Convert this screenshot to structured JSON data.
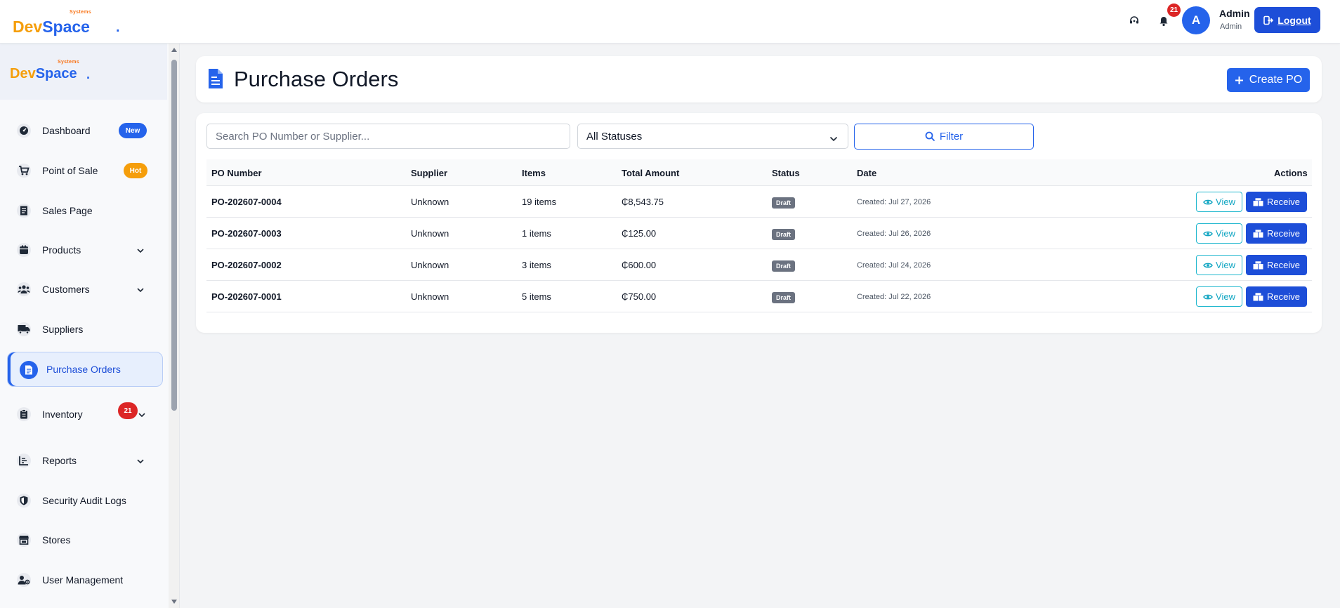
{
  "brand": {
    "small": "Systems",
    "dev": "Dev",
    "space": "Space",
    "dot": "."
  },
  "header": {
    "notification_count": "21",
    "avatar_initial": "A",
    "user_name": "Admin",
    "user_role": "Admin",
    "logout_label": "Logout",
    "icons": [
      "headset-icon",
      "bell-icon",
      "logout-icon"
    ]
  },
  "sidebar": {
    "items": [
      {
        "label": "Dashboard",
        "icon": "dashboard-icon",
        "pill": "New",
        "pill_color": "#2563eb"
      },
      {
        "label": "Point of Sale",
        "icon": "cart-icon",
        "pill": "Hot",
        "pill_color": "#f59e0b"
      },
      {
        "label": "Sales Page",
        "icon": "receipt-icon"
      },
      {
        "label": "Products",
        "icon": "box-icon",
        "expandable": true
      },
      {
        "label": "Customers",
        "icon": "users-icon",
        "expandable": true
      },
      {
        "label": "Suppliers",
        "icon": "truck-icon"
      },
      {
        "label": "Purchase Orders",
        "icon": "file-icon",
        "active": true
      },
      {
        "label": "Inventory",
        "icon": "clipboard-icon",
        "expandable": true,
        "badge": "21"
      },
      {
        "label": "Reports",
        "icon": "chart-icon",
        "expandable": true
      },
      {
        "label": "Security Audit Logs",
        "icon": "shield-icon"
      },
      {
        "label": "Stores",
        "icon": "store-icon"
      },
      {
        "label": "User Management",
        "icon": "user-cog-icon"
      }
    ]
  },
  "page": {
    "title": "Purchase Orders",
    "create_label": "Create PO"
  },
  "filters": {
    "search_placeholder": "Search PO Number or Supplier...",
    "status_selected": "All Statuses",
    "filter_label": "Filter"
  },
  "table": {
    "headers": [
      "PO Number",
      "Supplier",
      "Items",
      "Total Amount",
      "Status",
      "Date",
      "Actions"
    ],
    "rows": [
      {
        "po": "PO-202607-0004",
        "supplier": "Unknown",
        "items": "19 items",
        "total": "₵8,543.75",
        "status": "Draft",
        "date": "Created: Jul 27, 2026"
      },
      {
        "po": "PO-202607-0003",
        "supplier": "Unknown",
        "items": "1 items",
        "total": "₵125.00",
        "status": "Draft",
        "date": "Created: Jul 26, 2026"
      },
      {
        "po": "PO-202607-0002",
        "supplier": "Unknown",
        "items": "3 items",
        "total": "₵600.00",
        "status": "Draft",
        "date": "Created: Jul 24, 2026"
      },
      {
        "po": "PO-202607-0001",
        "supplier": "Unknown",
        "items": "5 items",
        "total": "₵750.00",
        "status": "Draft",
        "date": "Created: Jul 22, 2026"
      }
    ],
    "view_label": "View",
    "receive_label": "Receive"
  },
  "colors": {
    "primary": "#2563eb",
    "primary_dark": "#1d4ed8",
    "danger": "#dc2626",
    "warning": "#f59e0b",
    "info": "#22b8cf",
    "draft": "#6b7280"
  }
}
